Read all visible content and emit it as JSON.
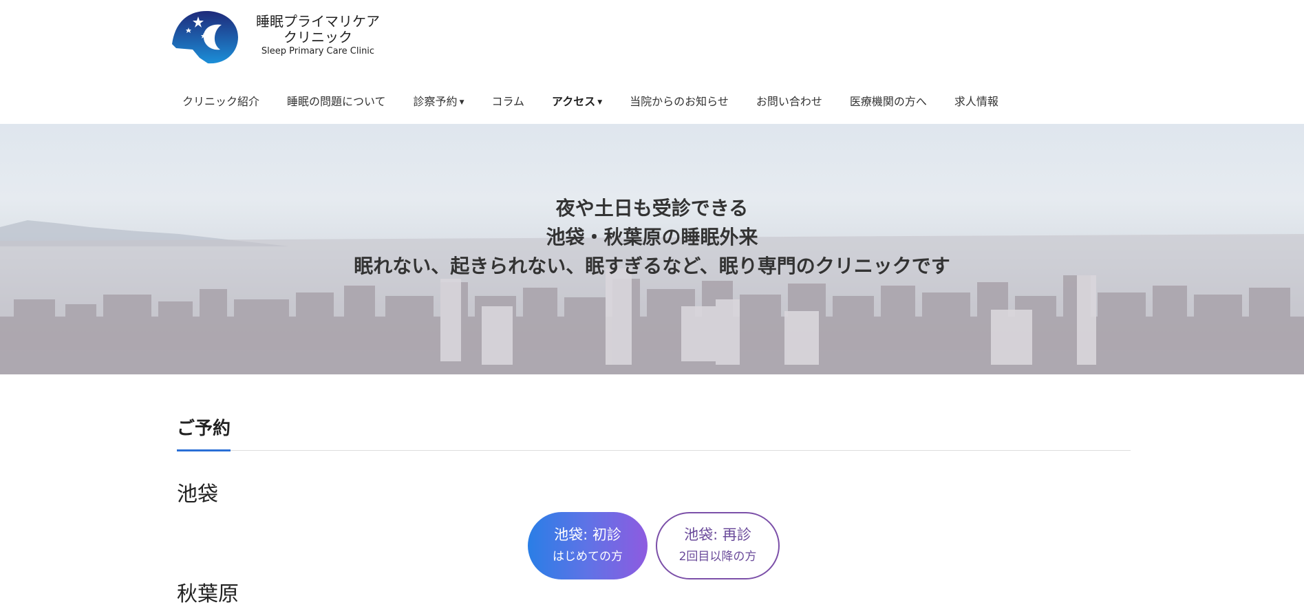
{
  "logo": {
    "name_jp_line1": "睡眠プライマリケア",
    "name_jp_line2": "クリニック",
    "name_en": "Sleep Primary Care Clinic"
  },
  "nav": {
    "items": [
      {
        "label": "クリニック紹介",
        "dropdown": false
      },
      {
        "label": "睡眠の問題について",
        "dropdown": false
      },
      {
        "label": "診察予約",
        "dropdown": true
      },
      {
        "label": "コラム",
        "dropdown": false
      },
      {
        "label": "アクセス",
        "dropdown": true,
        "active": true
      },
      {
        "label": "当院からのお知らせ",
        "dropdown": false
      },
      {
        "label": "お問い合わせ",
        "dropdown": false
      },
      {
        "label": "医療機関の方へ",
        "dropdown": false
      },
      {
        "label": "求人情報",
        "dropdown": false
      }
    ]
  },
  "hero": {
    "line1": "夜や土日も受診できる",
    "line2": "池袋・秋葉原の睡眠外来",
    "line3": "眠れない、起きられない、眠すぎるなど、眠り専門のクリニックです"
  },
  "booking": {
    "title": "ご予約",
    "location1": "池袋",
    "first_visit": {
      "main": "池袋: 初診",
      "sub": "はじめての方"
    },
    "return_visit": {
      "main": "池袋: 再診",
      "sub": "2回目以降の方"
    },
    "location2": "秋葉原"
  },
  "colors": {
    "accent": "#2a6fd6",
    "btn_gradient_start": "#2a7ee6",
    "btn_gradient_end": "#8e5be0",
    "outline": "#7b4fa8"
  }
}
